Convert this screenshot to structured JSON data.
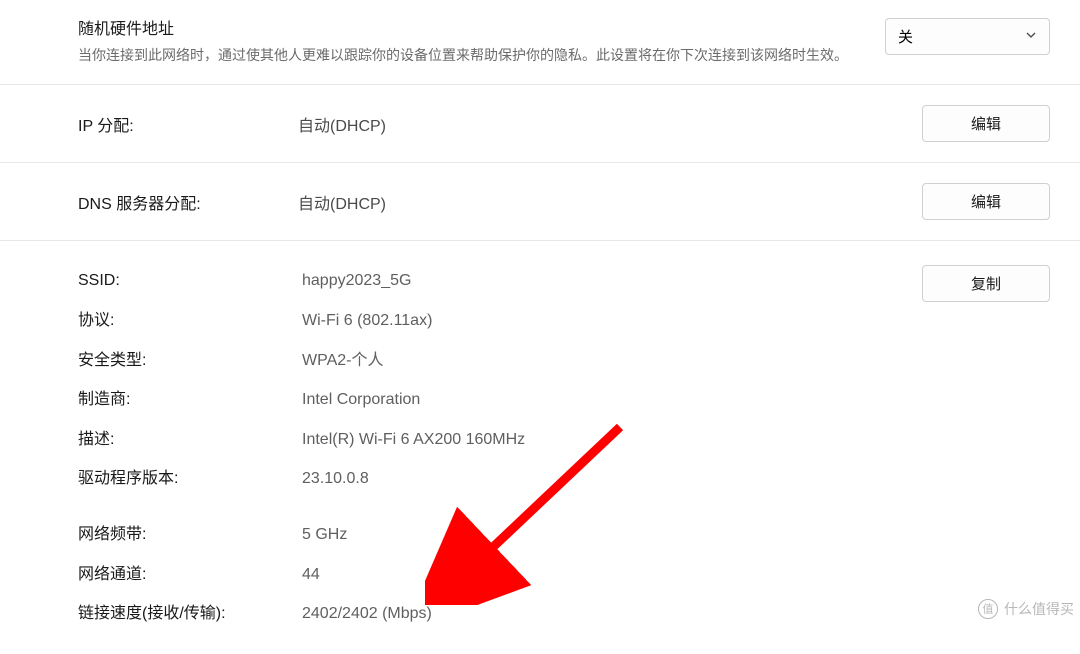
{
  "random_mac": {
    "title": "随机硬件地址",
    "desc": "当你连接到此网络时，通过使其他人更难以跟踪你的设备位置来帮助保护你的隐私。此设置将在你下次连接到该网络时生效。",
    "dropdown_value": "关"
  },
  "ip_assign": {
    "label": "IP 分配:",
    "value": "自动(DHCP)",
    "button": "编辑"
  },
  "dns_assign": {
    "label": "DNS 服务器分配:",
    "value": "自动(DHCP)",
    "button": "编辑"
  },
  "details": {
    "copy_button": "复制",
    "rows": [
      {
        "label": "SSID:",
        "value": "happy2023_5G"
      },
      {
        "label": "协议:",
        "value": "Wi-Fi 6 (802.11ax)"
      },
      {
        "label": "安全类型:",
        "value": "WPA2-个人"
      },
      {
        "label": "制造商:",
        "value": "Intel Corporation"
      },
      {
        "label": "描述:",
        "value": "Intel(R) Wi-Fi 6 AX200 160MHz"
      },
      {
        "label": "驱动程序版本:",
        "value": "23.10.0.8"
      }
    ],
    "rows2": [
      {
        "label": "网络频带:",
        "value": "5 GHz"
      },
      {
        "label": "网络通道:",
        "value": "44"
      },
      {
        "label": "链接速度(接收/传输):",
        "value": "2402/2402 (Mbps)"
      }
    ]
  },
  "watermark": "什么值得买"
}
